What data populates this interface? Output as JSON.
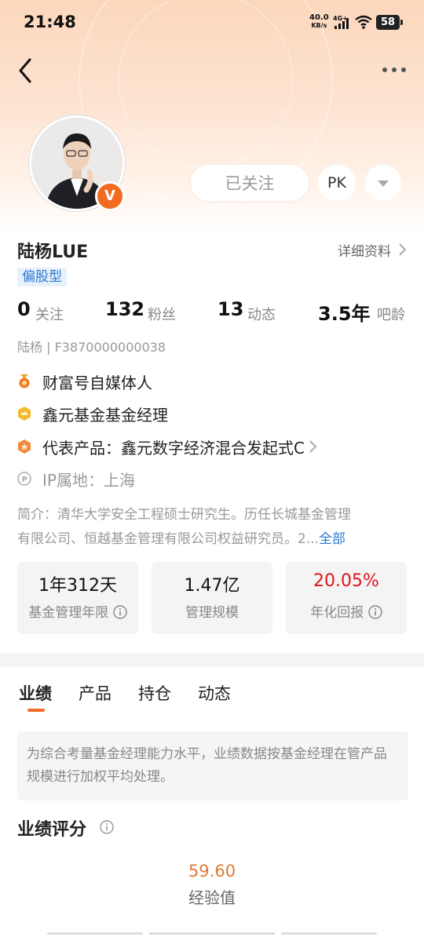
{
  "status_bar": {
    "time": "21:48",
    "net_speed": "40.0",
    "net_unit": "KB/s",
    "net_type": "4G+",
    "battery": "58"
  },
  "header": {
    "back_icon": "chevron-left-icon",
    "more_icon": "more-dots-icon"
  },
  "profile": {
    "verified_badge": "V",
    "follow_label": "已关注",
    "pk_label": "PK",
    "name": "陆杨LUE",
    "detail_label": "详细资料",
    "tag": "偏股型",
    "stats": [
      {
        "value": "0",
        "label": "关注"
      },
      {
        "value": "132",
        "label": "粉丝"
      },
      {
        "value": "13",
        "label": "动态"
      },
      {
        "value": "3.5年",
        "label": "吧龄"
      }
    ],
    "uid": "陆杨 | F3870000000038",
    "info": [
      {
        "icon": "medal-icon",
        "text": "财富号自媒体人"
      },
      {
        "icon": "crown-icon",
        "text": "鑫元基金基金经理"
      },
      {
        "icon": "product-icon",
        "text": "代表产品：鑫元数字经济混合发起式C"
      },
      {
        "icon": "location-icon",
        "text": "IP属地：上海"
      }
    ],
    "intro_line1": "简介：清华大学安全工程硕士研究生。历任长城基金管理",
    "intro_line2": "有限公司、恒越基金管理有限公司权益研究员。2...",
    "intro_all": "全部"
  },
  "metrics": [
    {
      "value": "1年312天",
      "label": "基金管理年限",
      "color": "#111111"
    },
    {
      "value": "1.47亿",
      "label": "管理规模",
      "color": "#111111"
    },
    {
      "value": "20.05%",
      "label": "年化回报",
      "color": "#e0141e"
    }
  ],
  "tabs": [
    "业绩",
    "产品",
    "持仓",
    "动态"
  ],
  "notice": "为综合考量基金经理能力水平，业绩数据按基金经理在管产品规模进行加权平均处理。",
  "performance": {
    "title": "业绩评分",
    "score": "59.60",
    "score_label": "经验值"
  },
  "colors": {
    "accent": "#f26b21",
    "link": "#2a7ad0",
    "positive": "#e0141e"
  }
}
